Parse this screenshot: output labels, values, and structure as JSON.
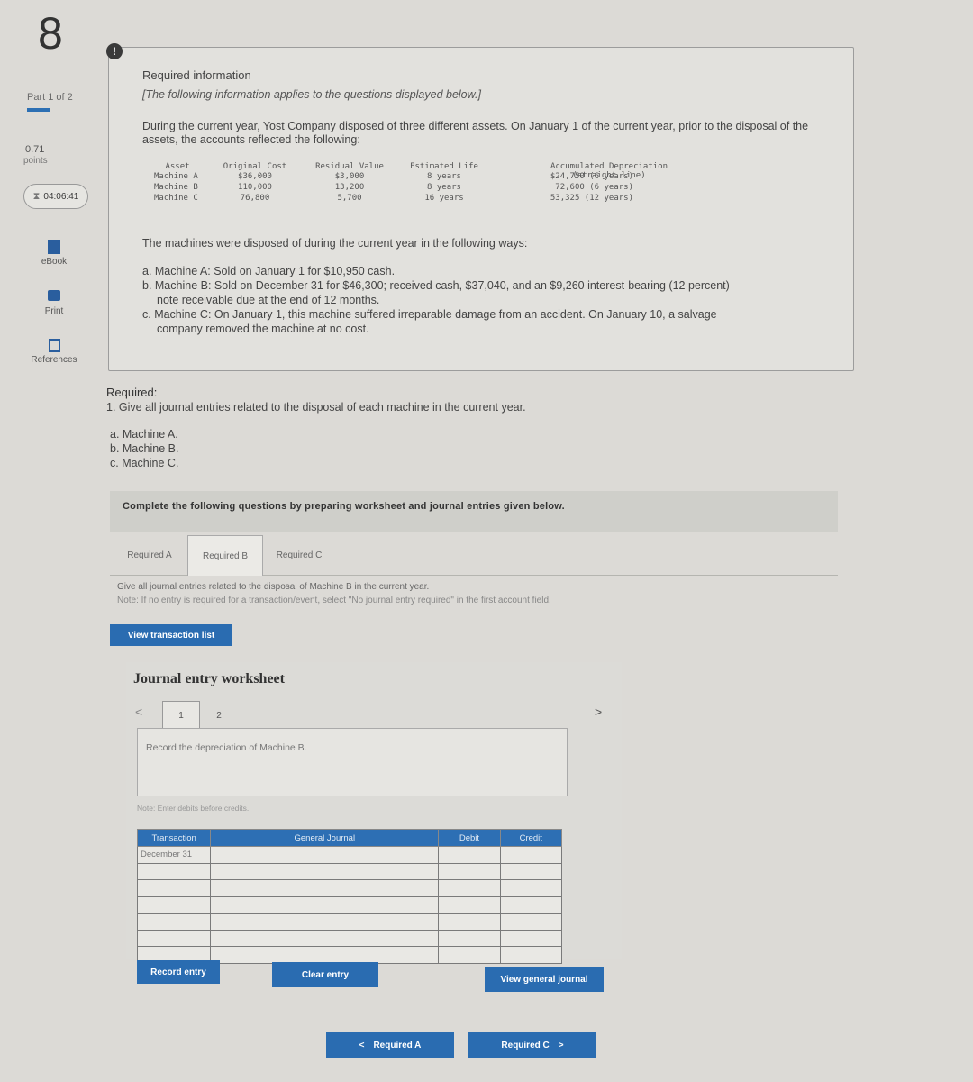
{
  "sidebar": {
    "question_number": "8",
    "part": "Part 1 of 2",
    "points_value": "0.71",
    "points_label": "points",
    "timer": "04:06:41",
    "ebook": "eBook",
    "print": "Print",
    "references": "References"
  },
  "info": {
    "title": "Required information",
    "subtitle": "[The following information applies to the questions displayed below.]",
    "intro": "During the current year, Yost Company disposed of three different assets. On January 1 of the current year, prior to the disposal of the assets, the accounts reflected the following:",
    "table": {
      "headers": [
        "Asset",
        "Original Cost",
        "Residual Value",
        "Estimated Life"
      ],
      "accum_header_1": "Accumulated Depreciation",
      "accum_header_2": "(straight line)",
      "rows": [
        {
          "asset": "Machine A",
          "cost": "$36,000",
          "residual": "$3,000",
          "life": "8 years",
          "accum": "$24,750 (6 years)"
        },
        {
          "asset": "Machine B",
          "cost": "110,000",
          "residual": "13,200",
          "life": "8 years",
          "accum": "72,600 (6 years)"
        },
        {
          "asset": "Machine C",
          "cost": "76,800",
          "residual": "5,700",
          "life": "16 years",
          "accum": "53,325 (12 years)"
        }
      ]
    },
    "disposed_intro": "The machines were disposed of during the current year in the following ways:",
    "ways": {
      "a": "a. Machine A: Sold on January 1 for $10,950 cash.",
      "b1": "b. Machine B: Sold on December 31 for $46,300; received cash, $37,040, and an $9,260 interest-bearing (12 percent)",
      "b2": "note receivable due at the end of 12 months.",
      "c1": "c. Machine C: On January 1, this machine suffered irreparable damage from an accident. On January 10, a salvage",
      "c2": "company removed the machine at no cost."
    }
  },
  "required": {
    "title": "Required:",
    "item1": "1. Give all journal entries related to the disposal of each machine in the current year.",
    "a": "a. Machine A.",
    "b": "b. Machine B.",
    "c": "c. Machine C."
  },
  "complete_text": "Complete the following questions by preparing worksheet and journal entries given below.",
  "tabs": [
    "Required A",
    "Required B",
    "Required C"
  ],
  "instructions": {
    "give": "Give all journal entries related to the disposal of Machine B in the current year.",
    "note": "Note: If no entry is required for a transaction/event, select \"No journal entry required\" in the first account field."
  },
  "view_transaction_list": "View transaction list",
  "worksheet": {
    "title": "Journal entry worksheet",
    "prev": "<",
    "next": ">",
    "pages": [
      "1",
      "2"
    ],
    "record_text": "Record the depreciation of Machine B.",
    "enter_note": "Note: Enter debits before credits.",
    "columns": [
      "Transaction",
      "General Journal",
      "Debit",
      "Credit"
    ],
    "first_transaction": "December 31",
    "record_entry": "Record entry",
    "clear_entry": "Clear entry",
    "view_general_journal": "View general journal"
  },
  "nav": {
    "prev_label": "Required A",
    "next_label": "Required C"
  }
}
